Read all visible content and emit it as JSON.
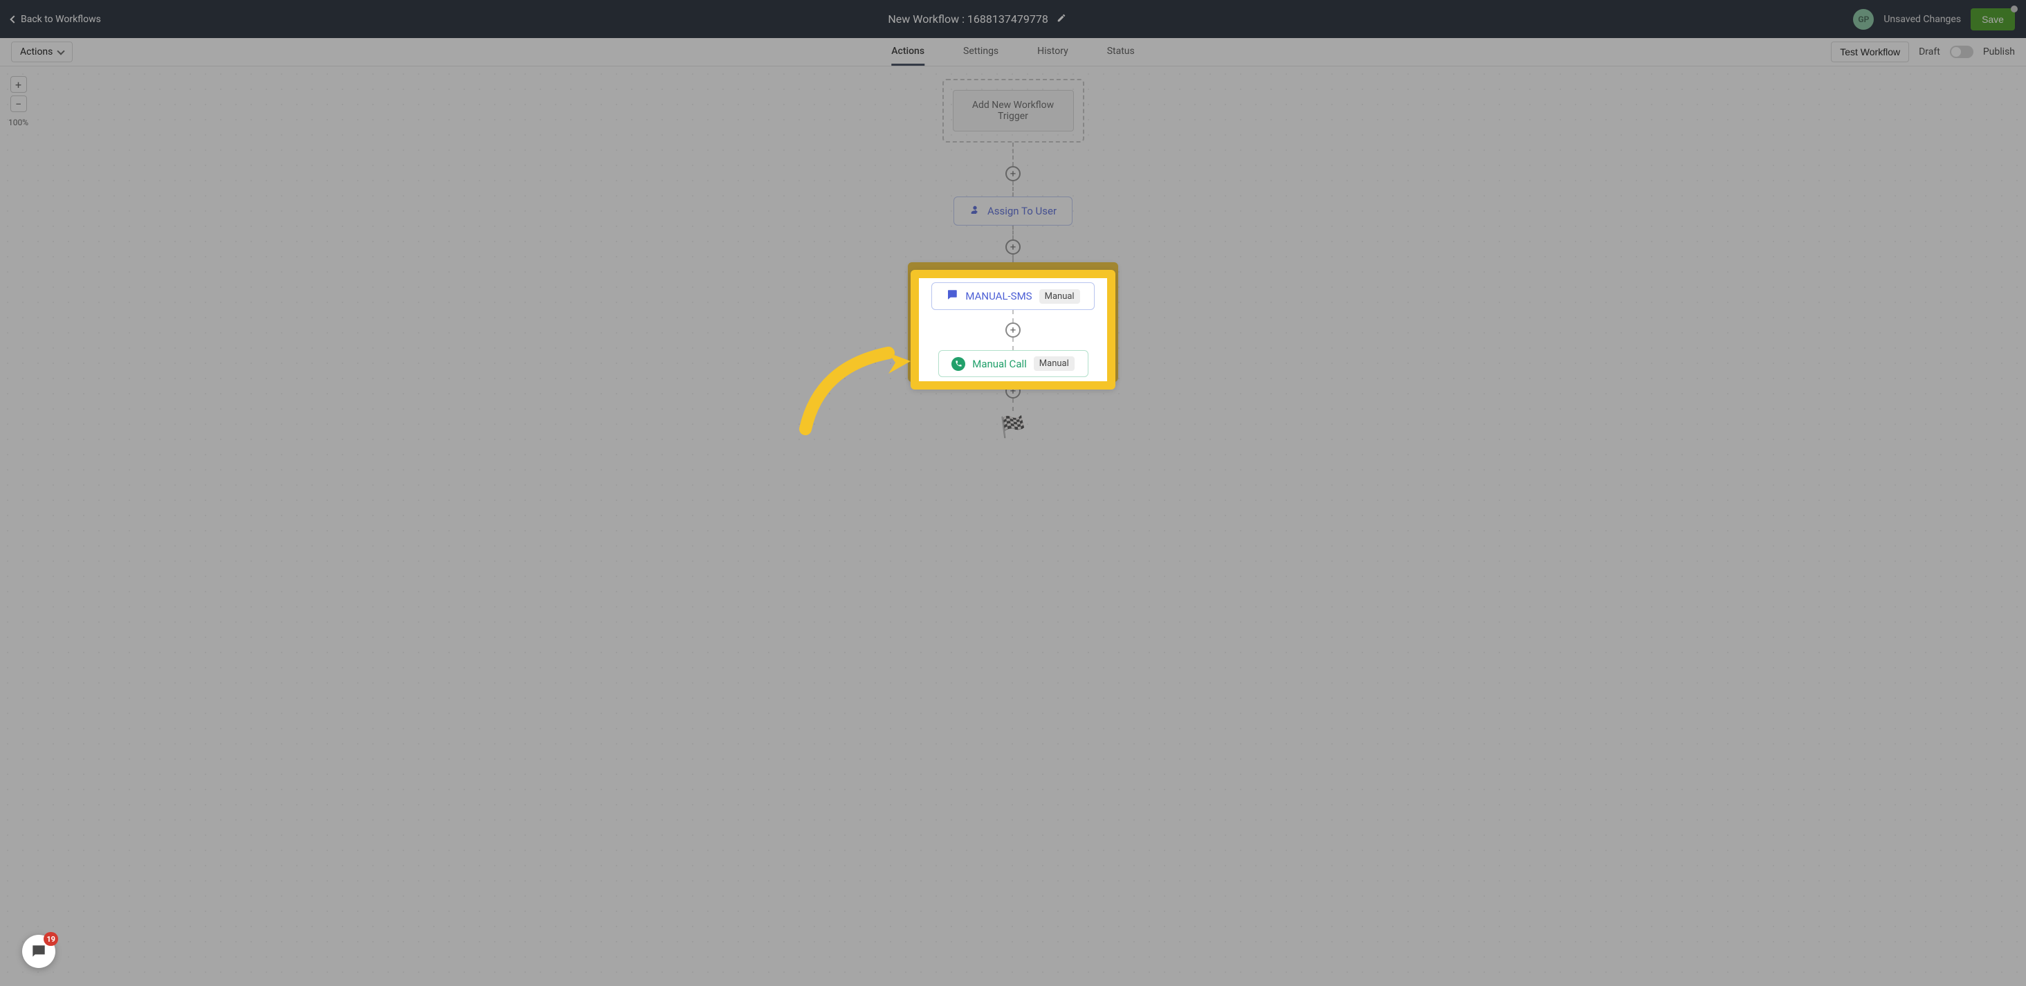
{
  "header": {
    "back_label": "Back to Workflows",
    "title": "New Workflow : 1688137479778",
    "avatar_initials": "GP",
    "unsaved_label": "Unsaved Changes",
    "save_label": "Save"
  },
  "subheader": {
    "actions_label": "Actions",
    "tabs": {
      "actions": "Actions",
      "settings": "Settings",
      "history": "History",
      "status": "Status"
    },
    "test_label": "Test Workflow",
    "draft_label": "Draft",
    "publish_label": "Publish"
  },
  "zoom": {
    "level": "100%"
  },
  "flow": {
    "trigger_label": "Add New Workflow Trigger",
    "assign_label": "Assign To User",
    "sms_label": "MANUAL-SMS",
    "sms_badge": "Manual",
    "call_label": "Manual Call",
    "call_badge": "Manual"
  },
  "chat": {
    "badge_count": "19"
  }
}
